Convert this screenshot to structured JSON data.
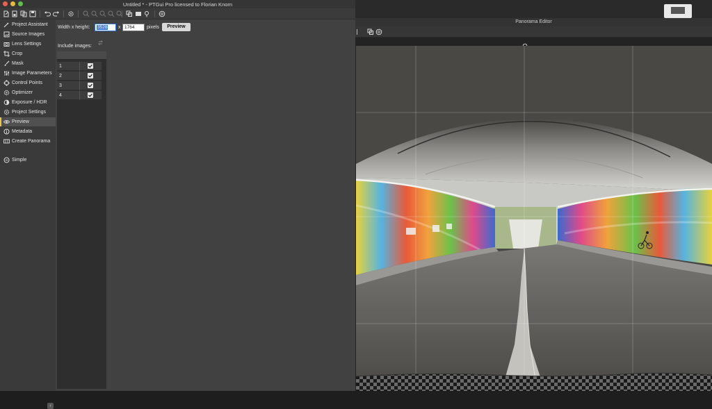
{
  "window": {
    "title": "Untitled * - PTGui Pro licensed to Florian Knorn"
  },
  "traffic_lights": {
    "close": "#ec5f55",
    "minimize": "#e9b93a",
    "zoom": "#5fbf47"
  },
  "toolbar_icons": [
    "new-project-icon",
    "open-icon",
    "duplicate-icon",
    "save-icon",
    "undo-icon",
    "redo-icon",
    "settings-icon",
    "zoom-in-icon",
    "zoom-out-icon",
    "zoom-fit-icon",
    "align-icon",
    "panorama-editor-icon",
    "detail-viewer-icon",
    "pin-icon",
    "help-icon"
  ],
  "sidebar": {
    "items": [
      {
        "label": "Project Assistant",
        "icon": "wand-icon"
      },
      {
        "label": "Source Images",
        "icon": "images-icon"
      },
      {
        "label": "Lens Settings",
        "icon": "camera-icon"
      },
      {
        "label": "Crop",
        "icon": "crop-icon"
      },
      {
        "label": "Mask",
        "icon": "brush-icon"
      },
      {
        "label": "Image Parameters",
        "icon": "sliders-icon"
      },
      {
        "label": "Control Points",
        "icon": "target-icon"
      },
      {
        "label": "Optimizer",
        "icon": "gear-icon"
      },
      {
        "label": "Exposure / HDR",
        "icon": "exposure-icon"
      },
      {
        "label": "Project Settings",
        "icon": "settings-icon"
      },
      {
        "label": "Preview",
        "icon": "eye-icon"
      },
      {
        "label": "Metadata",
        "icon": "info-icon"
      },
      {
        "label": "Create Panorama",
        "icon": "panorama-icon"
      }
    ],
    "active": "Preview",
    "accent": "#e8c84a",
    "simple_label": "Simple"
  },
  "preview": {
    "size_label": "Width x height:",
    "width_value": "3528",
    "times": "x",
    "height_value": "1764",
    "units": "pixels",
    "preview_button": "Preview",
    "include_label": "Include images:",
    "images": [
      {
        "index": "1",
        "checked": true
      },
      {
        "index": "2",
        "checked": true
      },
      {
        "index": "3",
        "checked": true
      },
      {
        "index": "4",
        "checked": true
      }
    ]
  },
  "editor": {
    "title": "Panorama Editor"
  }
}
